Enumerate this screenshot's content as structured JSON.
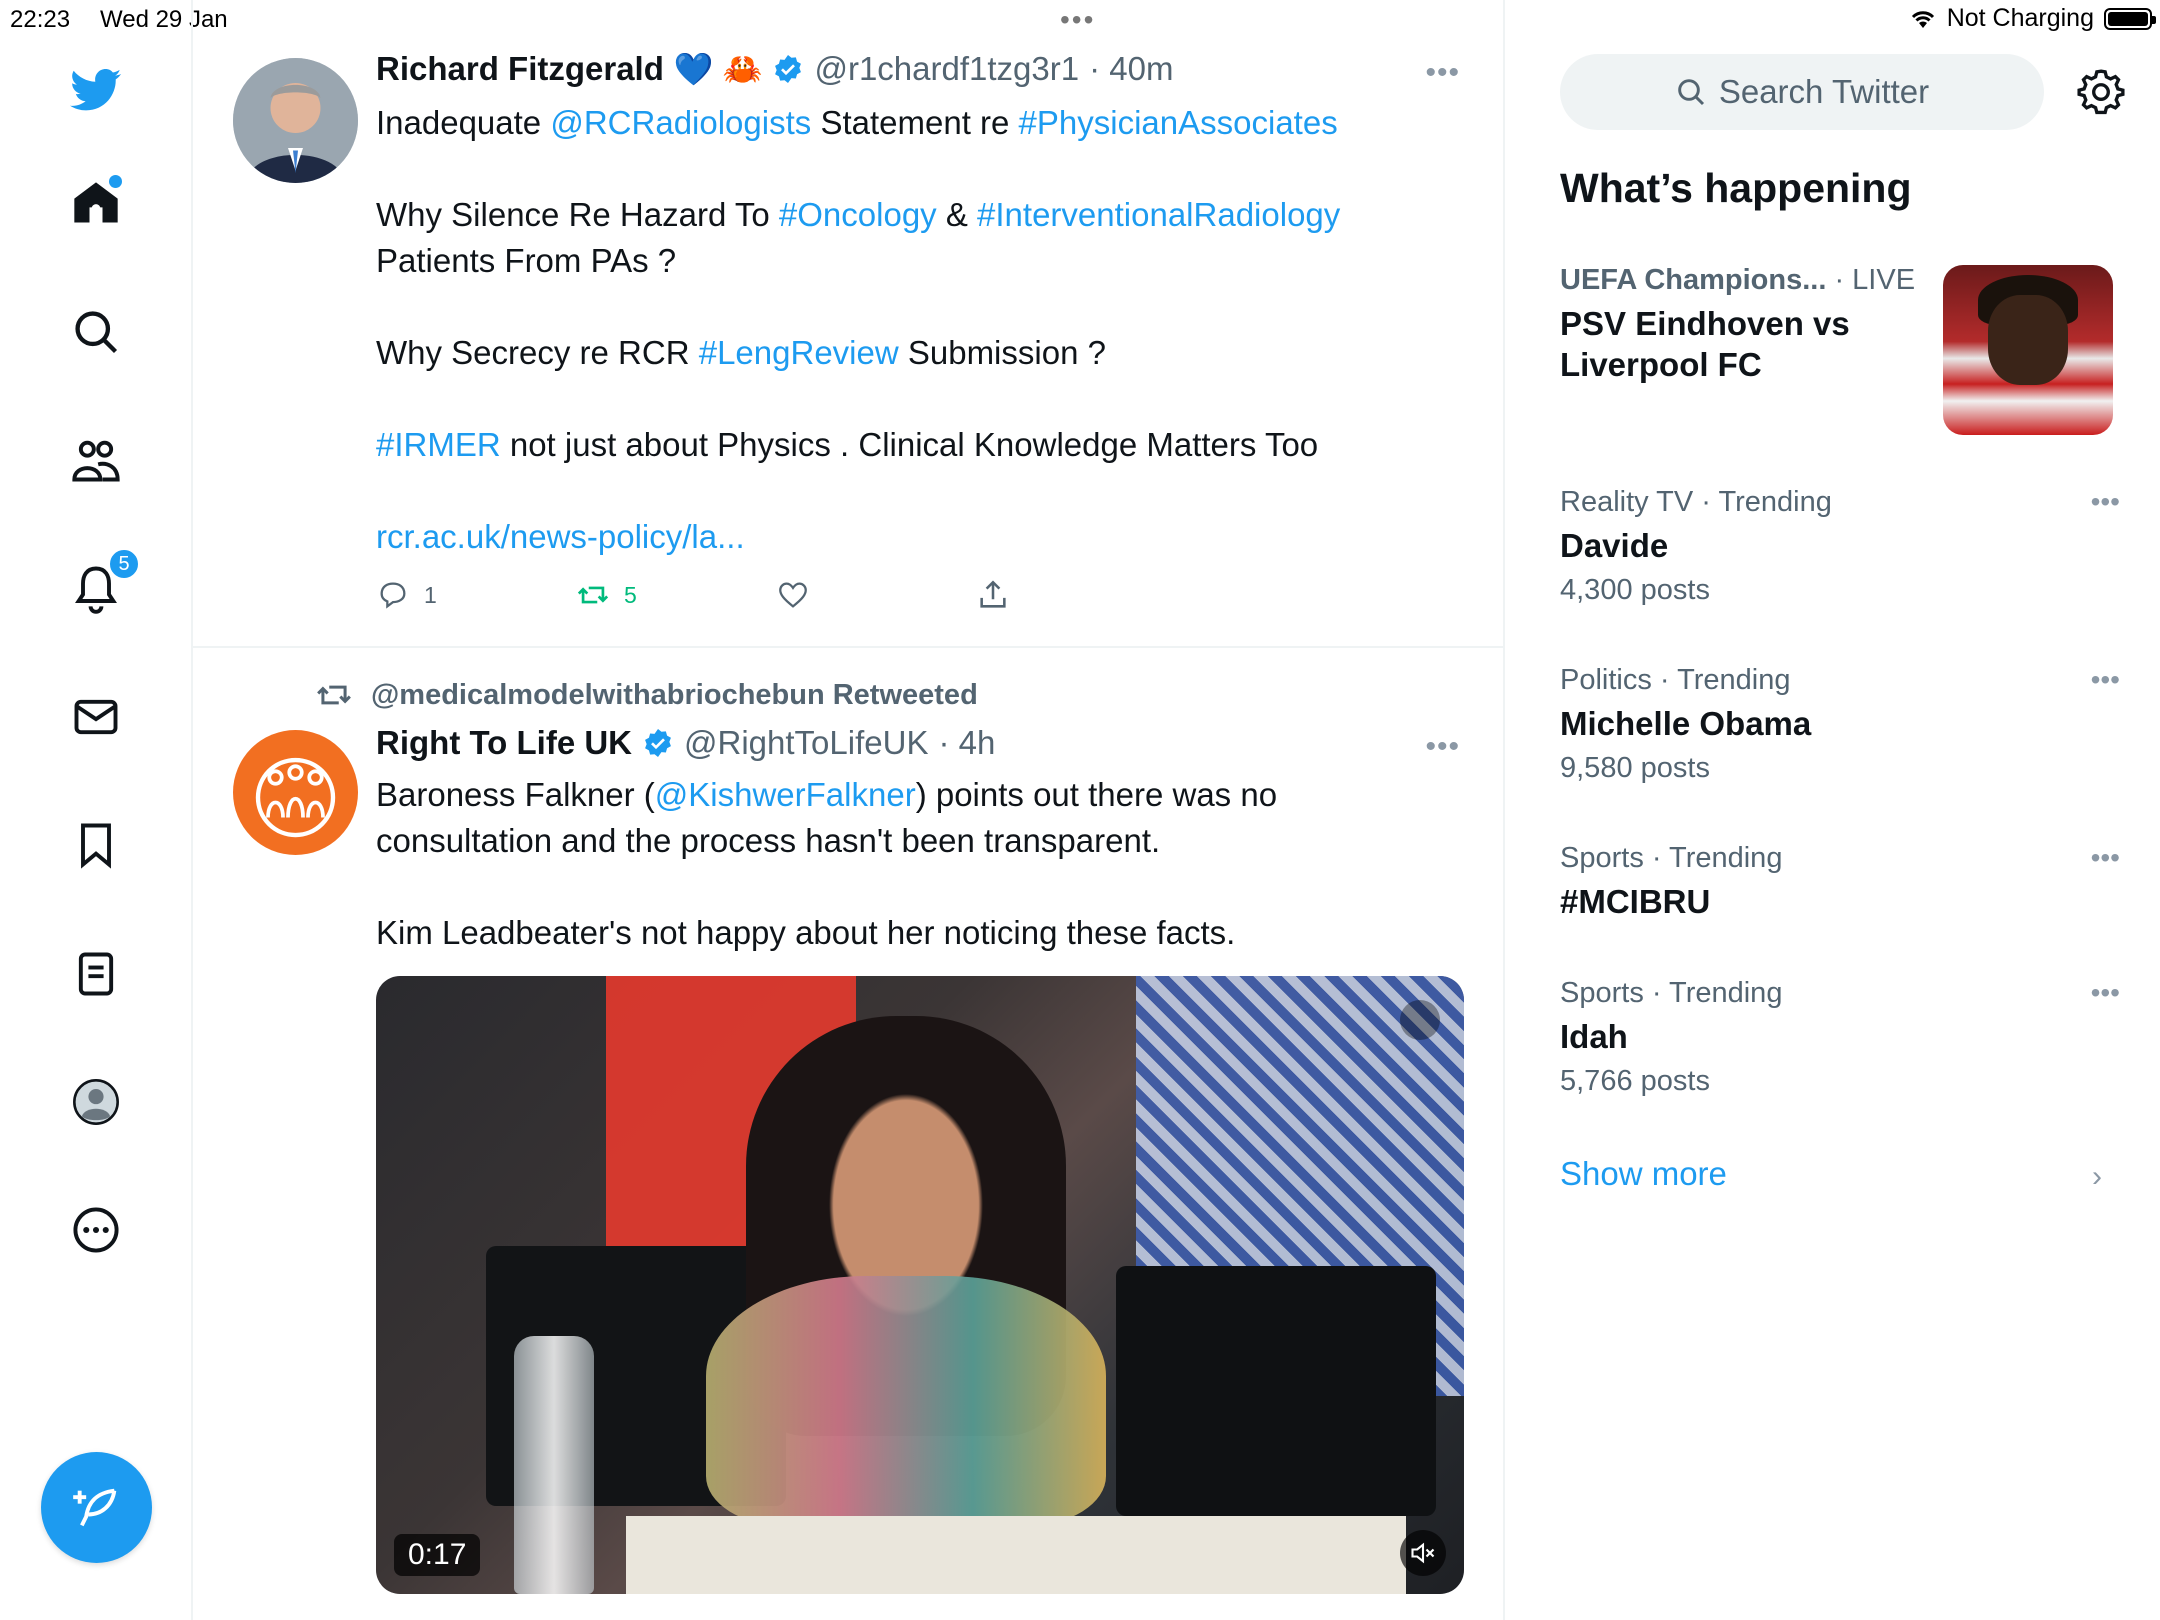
{
  "status_bar": {
    "time": "22:23",
    "date": "Wed 29 Jan",
    "charging": "Not Charging"
  },
  "nav": {
    "notifications_badge": "5",
    "items": [
      "twitter-logo",
      "home-icon",
      "search-icon",
      "communities-icon",
      "notifications-icon",
      "messages-icon",
      "bookmarks-icon",
      "lists-icon",
      "profile-icon",
      "more-icon"
    ]
  },
  "tweets": [
    {
      "name": "Richard Fitzgerald",
      "emoji": "💙 🦀",
      "handle": "@r1chardf1tzg3r1",
      "time": "· 40m",
      "lines": {
        "l1a": "Inadequate ",
        "l1b": "@RCRadiologists",
        "l1c": " Statement re ",
        "l1d": "#PhysicianAssociates",
        "l2a": "Why Silence Re Hazard To ",
        "l2b": "#Oncology",
        "l2c": " & ",
        "l2d": "#InterventionalRadiology",
        "l3": "Patients From PAs ?",
        "l4a": "Why Secrecy re RCR ",
        "l4b": "#LengReview",
        "l4c": " Submission ?",
        "l5a": "#IRMER",
        "l5b": " not just about Physics . Clinical Knowledge Matters Too",
        "l6": "rcr.ac.uk/news-policy/la..."
      },
      "replies": "1",
      "retweets": "5",
      "likes": ""
    },
    {
      "retweeted_by": "@medicalmodelwithabriochebun Retweeted",
      "name": "Right To Life UK",
      "handle": "@RightToLifeUK",
      "time": "· 4h",
      "lines": {
        "l1a": "Baroness Falkner (",
        "l1b": "@KishwerFalkner",
        "l1c": ") points out there was no",
        "l2": "consultation and the process hasn't been transparent.",
        "l3": "Kim Leadbeater's not happy about her noticing these facts."
      },
      "video_time": "0:17"
    }
  ],
  "sidebar": {
    "search_placeholder": "Search Twitter",
    "title": "What’s happening",
    "trends": [
      {
        "meta": "UEFA Champions...",
        "meta2": " · LIVE",
        "title": "PSV Eindhoven vs Liverpool FC",
        "count": ""
      },
      {
        "meta": "Reality TV · Trending",
        "title": "Davide",
        "count": "4,300 posts"
      },
      {
        "meta": "Politics · Trending",
        "title": "Michelle Obama",
        "count": "9,580 posts"
      },
      {
        "meta": "Sports · Trending",
        "title": "#MCIBRU",
        "count": ""
      },
      {
        "meta": "Sports · Trending",
        "title": "Idah",
        "count": "5,766 posts"
      }
    ],
    "show_more": "Show more"
  },
  "colors": {
    "accent": "#1d9bf0",
    "retweet_green": "#00ba7c",
    "text_secondary": "#536471",
    "avatar_rtl": "#f26f21"
  }
}
